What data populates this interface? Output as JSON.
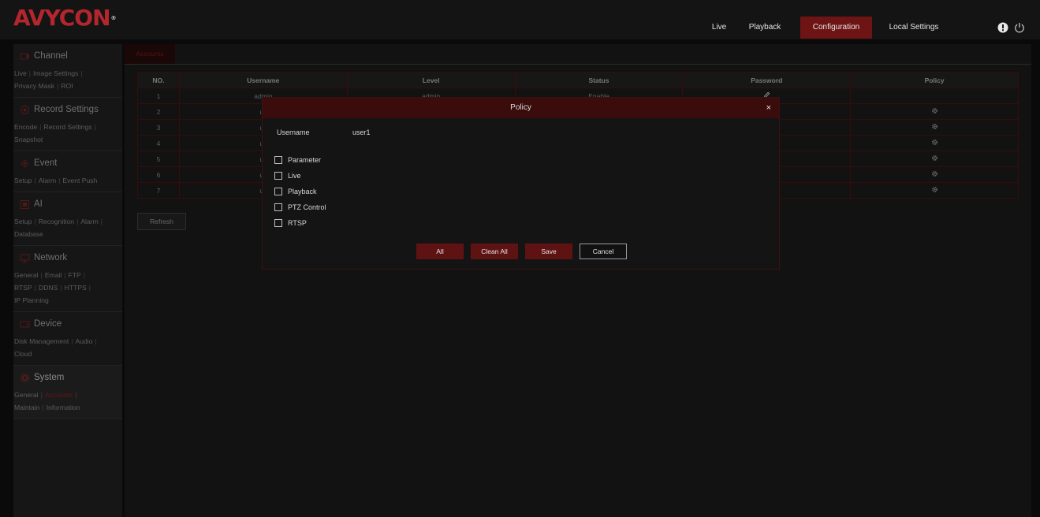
{
  "app": {
    "logo_text": "AVYCON",
    "logo_mark": "®"
  },
  "nav": {
    "items": [
      {
        "label": "Live"
      },
      {
        "label": "Playback"
      },
      {
        "label": "Configuration"
      },
      {
        "label": "Local Settings"
      }
    ],
    "active": "Configuration",
    "icons": [
      "info-icon",
      "power-icon"
    ]
  },
  "sidebar": {
    "sections": [
      {
        "title": "Channel",
        "icon": "camera-icon",
        "links": [
          "Live",
          "Image Settings",
          "Privacy Mask",
          "ROI"
        ]
      },
      {
        "title": "Record Settings",
        "icon": "record-icon",
        "links": [
          "Encode",
          "Record Settings",
          "Snapshot"
        ]
      },
      {
        "title": "Event",
        "icon": "event-icon",
        "links": [
          "Setup",
          "Alarm",
          "Event Push"
        ]
      },
      {
        "title": "AI",
        "icon": "ai-icon",
        "links": [
          "Setup",
          "Recognition",
          "Alarm",
          "Database"
        ]
      },
      {
        "title": "Network",
        "icon": "network-icon",
        "links": [
          "General",
          "Email",
          "FTP",
          "RTSP",
          "DDNS",
          "HTTPS",
          "IP Planning"
        ]
      },
      {
        "title": "Device",
        "icon": "device-icon",
        "links": [
          "Disk Management",
          "Audio",
          "Cloud"
        ]
      },
      {
        "title": "System",
        "icon": "system-icon",
        "links": [
          "General",
          "Accounts",
          "Maintain",
          "Information"
        ]
      }
    ],
    "active_section": "System",
    "active_link": "Accounts"
  },
  "main": {
    "tab_label": "Accounts",
    "table": {
      "headers": [
        "NO.",
        "Username",
        "Level",
        "Status",
        "Password",
        "Policy"
      ],
      "rows": [
        {
          "no": "1",
          "username": "admin",
          "level": "admin",
          "status": "Enable",
          "password_icon": "edit-icon",
          "policy_icon": ""
        },
        {
          "no": "2",
          "username": "us",
          "level": "",
          "status": "",
          "password_icon": "",
          "policy_icon": "gear-icon"
        },
        {
          "no": "3",
          "username": "us",
          "level": "",
          "status": "",
          "password_icon": "",
          "policy_icon": "gear-icon"
        },
        {
          "no": "4",
          "username": "us",
          "level": "",
          "status": "",
          "password_icon": "",
          "policy_icon": "gear-icon"
        },
        {
          "no": "5",
          "username": "us",
          "level": "",
          "status": "",
          "password_icon": "",
          "policy_icon": "gear-icon"
        },
        {
          "no": "6",
          "username": "us",
          "level": "",
          "status": "",
          "password_icon": "",
          "policy_icon": "gear-icon"
        },
        {
          "no": "7",
          "username": "us",
          "level": "",
          "status": "",
          "password_icon": "",
          "policy_icon": "gear-icon"
        }
      ]
    },
    "refresh_label": "Refresh"
  },
  "dialog": {
    "title": "Policy",
    "close_glyph": "×",
    "username_label": "Username",
    "username_value": "user1",
    "permissions": [
      {
        "label": "Parameter",
        "checked": false
      },
      {
        "label": "Live",
        "checked": false
      },
      {
        "label": "Playback",
        "checked": false
      },
      {
        "label": "PTZ Control",
        "checked": false
      },
      {
        "label": "RTSP",
        "checked": false
      }
    ],
    "buttons": {
      "all": "All",
      "clean_all": "Clean All",
      "save": "Save",
      "cancel": "Cancel"
    }
  },
  "colors": {
    "accent_red": "#6e1414",
    "dialog_header": "#3a0c0c",
    "background": "#0a0a0a"
  }
}
